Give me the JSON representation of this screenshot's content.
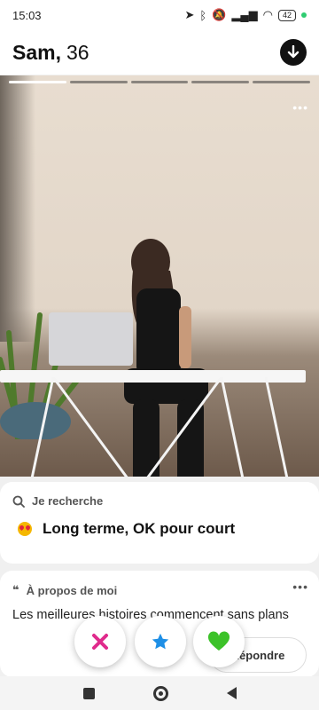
{
  "status": {
    "time": "15:03",
    "battery": "42"
  },
  "profile": {
    "name": "Sam,",
    "age": "36"
  },
  "photo": {
    "total_photos": 5,
    "current_index": 1
  },
  "reply_button": {
    "label": "Répondre"
  },
  "looking_for": {
    "title": "Je recherche",
    "value": "Long terme, OK pour court"
  },
  "about": {
    "title": "À propos de moi",
    "text": "Les meilleures histoires commencent sans plans"
  },
  "colors": {
    "accent_blue": "#1e6fe6",
    "pass_pink": "#e02a8c",
    "like_green": "#3cc229"
  }
}
